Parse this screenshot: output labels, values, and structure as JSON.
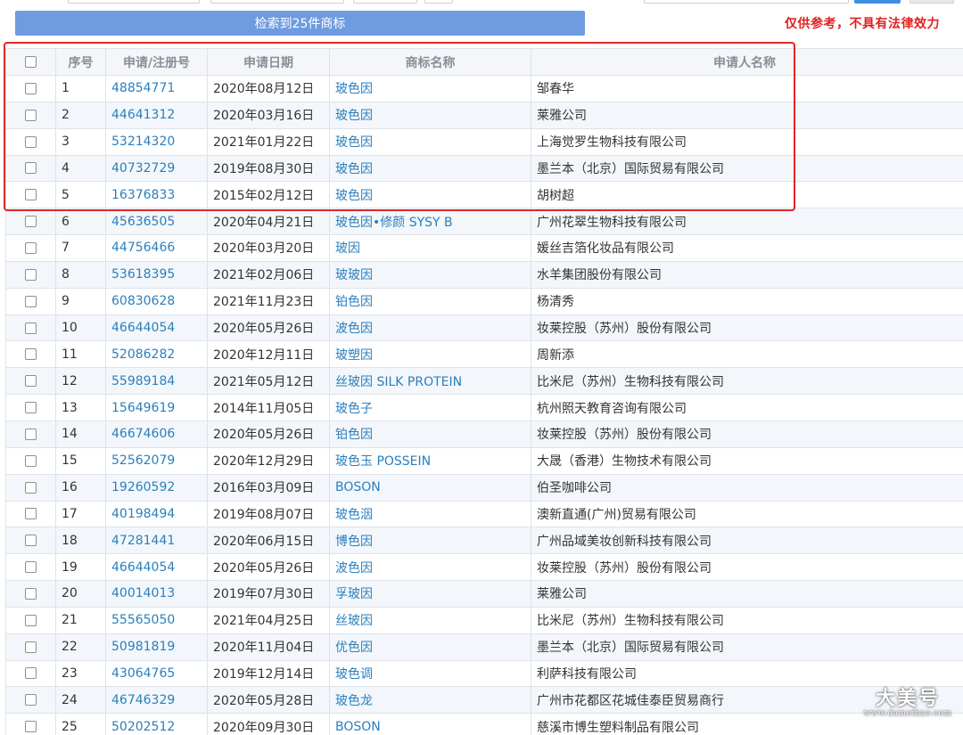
{
  "search_banner": "检索到25件商标",
  "disclaimer": "仅供参考，不具有法律效力",
  "table": {
    "headers": {
      "seq": "序号",
      "reg_no": "申请/注册号",
      "date": "申请日期",
      "mark": "商标名称",
      "applicant": "申请人名称"
    },
    "rows": [
      {
        "seq": "1",
        "reg_no": "48854771",
        "date": "2020年08月12日",
        "mark": "玻色因",
        "applicant": "邹春华"
      },
      {
        "seq": "2",
        "reg_no": "44641312",
        "date": "2020年03月16日",
        "mark": "玻色因",
        "applicant": "莱雅公司"
      },
      {
        "seq": "3",
        "reg_no": "53214320",
        "date": "2021年01月22日",
        "mark": "玻色因",
        "applicant": "上海觉罗生物科技有限公司"
      },
      {
        "seq": "4",
        "reg_no": "40732729",
        "date": "2019年08月30日",
        "mark": "玻色因",
        "applicant": "墨兰本（北京）国际贸易有限公司"
      },
      {
        "seq": "5",
        "reg_no": "16376833",
        "date": "2015年02月12日",
        "mark": "玻色因",
        "applicant": "胡树超"
      },
      {
        "seq": "6",
        "reg_no": "45636505",
        "date": "2020年04月21日",
        "mark": "玻色因•修颜 SYSY B",
        "applicant": "广州花翠生物科技有限公司"
      },
      {
        "seq": "7",
        "reg_no": "44756466",
        "date": "2020年03月20日",
        "mark": "玻因",
        "applicant": "媛丝吉箔化妆品有限公司"
      },
      {
        "seq": "8",
        "reg_no": "53618395",
        "date": "2021年02月06日",
        "mark": "玻玻因",
        "applicant": "水羊集团股份有限公司"
      },
      {
        "seq": "9",
        "reg_no": "60830628",
        "date": "2021年11月23日",
        "mark": "铂色因",
        "applicant": "杨清秀"
      },
      {
        "seq": "10",
        "reg_no": "46644054",
        "date": "2020年05月26日",
        "mark": "波色因",
        "applicant": "妆莱控股（苏州）股份有限公司"
      },
      {
        "seq": "11",
        "reg_no": "52086282",
        "date": "2020年12月11日",
        "mark": "玻塑因",
        "applicant": "周新添"
      },
      {
        "seq": "12",
        "reg_no": "55989184",
        "date": "2021年05月12日",
        "mark": "丝玻因 SILK PROTEIN",
        "applicant": "比米尼（苏州）生物科技有限公司"
      },
      {
        "seq": "13",
        "reg_no": "15649619",
        "date": "2014年11月05日",
        "mark": "玻色子",
        "applicant": "杭州照天教育咨询有限公司"
      },
      {
        "seq": "14",
        "reg_no": "46674606",
        "date": "2020年05月26日",
        "mark": "铂色因",
        "applicant": "妆莱控股（苏州）股份有限公司"
      },
      {
        "seq": "15",
        "reg_no": "52562079",
        "date": "2020年12月29日",
        "mark": "玻色玉 POSSEIN",
        "applicant": "大晟（香港）生物技术有限公司"
      },
      {
        "seq": "16",
        "reg_no": "19260592",
        "date": "2016年03月09日",
        "mark": "BOSON",
        "applicant": "伯圣咖啡公司"
      },
      {
        "seq": "17",
        "reg_no": "40198494",
        "date": "2019年08月07日",
        "mark": "玻色洇",
        "applicant": "澳新直通(广州)贸易有限公司"
      },
      {
        "seq": "18",
        "reg_no": "47281441",
        "date": "2020年06月15日",
        "mark": "博色因",
        "applicant": "广州品域美妆创新科技有限公司"
      },
      {
        "seq": "19",
        "reg_no": "46644054",
        "date": "2020年05月26日",
        "mark": "波色因",
        "applicant": "妆莱控股（苏州）股份有限公司"
      },
      {
        "seq": "20",
        "reg_no": "40014013",
        "date": "2019年07月30日",
        "mark": "孚玻因",
        "applicant": "莱雅公司"
      },
      {
        "seq": "21",
        "reg_no": "55565050",
        "date": "2021年04月25日",
        "mark": "丝玻因",
        "applicant": "比米尼（苏州）生物科技有限公司"
      },
      {
        "seq": "22",
        "reg_no": "50981819",
        "date": "2020年11月04日",
        "mark": "优色因",
        "applicant": "墨兰本（北京）国际贸易有限公司"
      },
      {
        "seq": "23",
        "reg_no": "43064765",
        "date": "2019年12月14日",
        "mark": "玻色调",
        "applicant": "利萨科技有限公司"
      },
      {
        "seq": "24",
        "reg_no": "46746329",
        "date": "2020年05月28日",
        "mark": "玻色龙",
        "applicant": "广州市花都区花城佳泰臣贸易商行"
      },
      {
        "seq": "25",
        "reg_no": "50202512",
        "date": "2020年09月30日",
        "mark": "BOSON",
        "applicant": "慈溪市博生塑料制品有限公司"
      }
    ]
  },
  "watermark": {
    "main": "大美号",
    "sub": "www.dameihao.com"
  },
  "colors": {
    "banner": "#6f9be0",
    "link": "#2b7fbd",
    "highlight": "#e02626",
    "disclaimer": "#e02020"
  }
}
